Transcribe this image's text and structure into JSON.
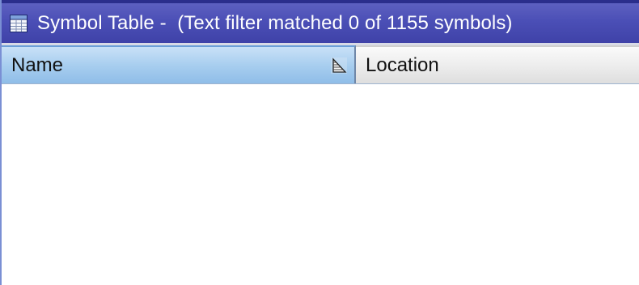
{
  "window": {
    "title": "Symbol Table -  (Text filter matched 0 of 1155 symbols)",
    "title_icon": "table-icon"
  },
  "table": {
    "columns": [
      {
        "label": "Name",
        "sort_icon": "sort-ascending-icon",
        "selected": true
      },
      {
        "label": "Location"
      }
    ],
    "rows": []
  },
  "colors": {
    "titlebar": "#4b4fb6",
    "selected_header": "#a8ceef",
    "header": "#ececec"
  }
}
